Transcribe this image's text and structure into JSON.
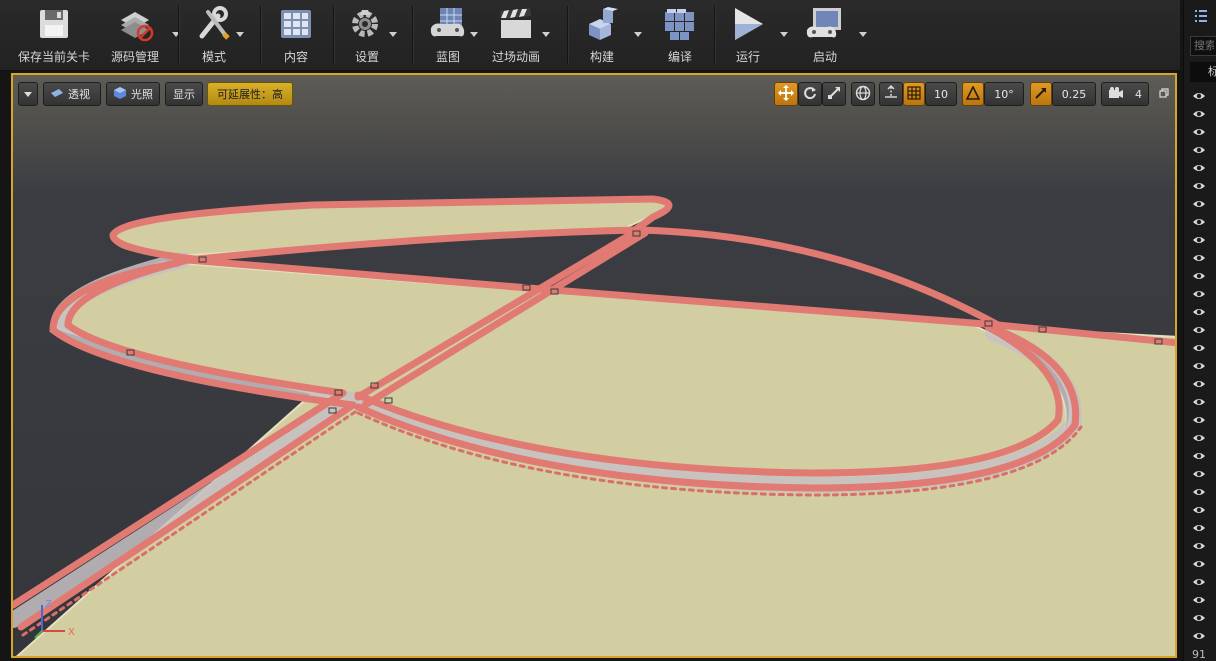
{
  "toolbar": {
    "save_label": "保存当前关卡",
    "source_label": "源码管理",
    "modes_label": "模式",
    "content_label": "内容",
    "settings_label": "设置",
    "blueprint_label": "蓝图",
    "cinematic_label": "过场动画",
    "build_label": "构建",
    "compile_label": "编译",
    "play_label": "运行",
    "launch_label": "启动"
  },
  "viewport_toolbar": {
    "perspective_label": "透视",
    "lit_label": "光照",
    "show_label": "显示",
    "scalability_label": "可延展性：高",
    "grid_snap_value": "10",
    "rotation_snap_value": "10°",
    "scale_snap_value": "0.25",
    "camera_speed_value": "4"
  },
  "axis": {
    "z_label": "Z",
    "x_label": "X"
  },
  "colors": {
    "viewport_border": "#d8a52a",
    "ground": "#d3cda2",
    "track": "#e07a72"
  },
  "right_panel": {
    "search_placeholder": "搜索",
    "header_glyph": "标",
    "bottom_value": "91"
  }
}
